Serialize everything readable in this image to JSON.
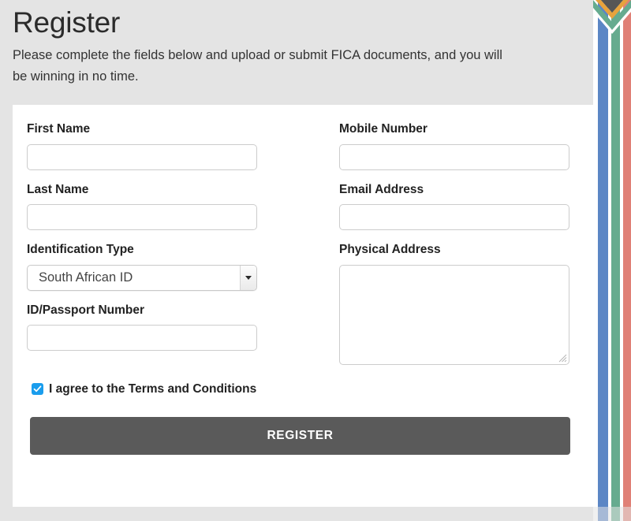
{
  "header": {
    "title": "Register",
    "intro": "Please complete the fields below and upload or submit FICA documents, and you will be winning in no time."
  },
  "form": {
    "left_column": [
      {
        "name": "first-name",
        "label": "First Name",
        "type": "text",
        "value": "",
        "placeholder": ""
      },
      {
        "name": "last-name",
        "label": "Last Name",
        "type": "text",
        "value": "",
        "placeholder": ""
      },
      {
        "name": "identification-type",
        "label": "Identification Type",
        "type": "select",
        "value": "South African ID",
        "options": [
          "South African ID"
        ]
      },
      {
        "name": "id-passport-number",
        "label": "ID/Passport Number",
        "type": "text",
        "value": "",
        "placeholder": ""
      }
    ],
    "right_column": [
      {
        "name": "mobile-number",
        "label": "Mobile Number",
        "type": "text",
        "value": "",
        "placeholder": ""
      },
      {
        "name": "email-address",
        "label": "Email Address",
        "type": "text",
        "value": "",
        "placeholder": ""
      },
      {
        "name": "physical-address",
        "label": "Physical Address",
        "type": "textarea",
        "value": "",
        "placeholder": ""
      }
    ],
    "terms": {
      "label": "I agree to the Terms and Conditions",
      "checked": true
    },
    "submit_label": "REGISTER"
  },
  "decoration": {
    "flag_name": "south-african-flag",
    "colors": {
      "red": "#e08076",
      "blue": "#5b86c5",
      "green": "#66ab8f",
      "gold": "#e8a33d",
      "black": "#565656",
      "white": "#ffffff"
    }
  },
  "theme": {
    "page_background": "#e4e4e4",
    "card_background": "#ffffff",
    "text": "#222222",
    "button_background": "#5a5a5a",
    "button_text": "#ffffff",
    "checkbox_accent": "#1a9ded",
    "input_border": "#cccccc"
  }
}
